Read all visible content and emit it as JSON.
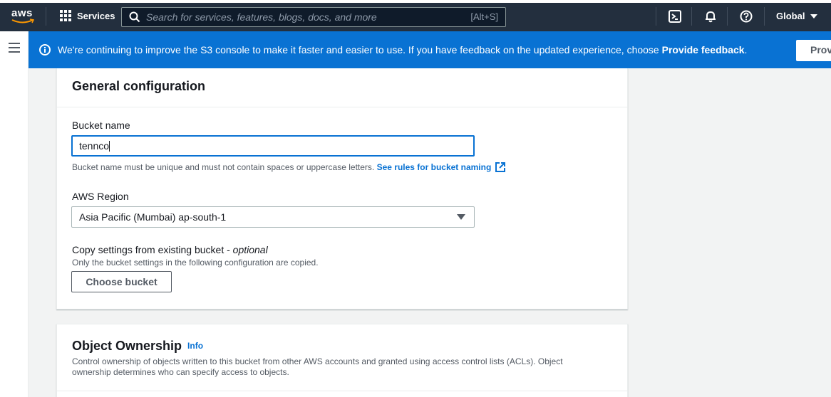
{
  "topnav": {
    "logo_text": "aws",
    "services_label": "Services",
    "search_placeholder": "Search for services, features, blogs, docs, and more",
    "search_shortcut": "[Alt+S]",
    "region_label": "Global",
    "icons": [
      "cloudshell-icon",
      "bell-icon",
      "help-icon",
      "caret-down-icon"
    ]
  },
  "flash": {
    "message_prefix": "We're continuing to improve the S3 console to make it faster and easier to use. If you have feedback on the updated experience, choose ",
    "message_link": "Provide feedback",
    "message_suffix": ".",
    "button_label": "Provide feedback"
  },
  "general": {
    "title": "General configuration",
    "bucket_name_label": "Bucket name",
    "bucket_name_value": "tennco",
    "bucket_name_hint": "Bucket name must be unique and must not contain spaces or uppercase letters.",
    "bucket_rules_link": "See rules for bucket naming",
    "region_label": "AWS Region",
    "region_value": "Asia Pacific (Mumbai) ap-south-1",
    "copy_label": "Copy settings from existing bucket - ",
    "copy_optional": "optional",
    "copy_hint": "Only the bucket settings in the following configuration are copied.",
    "choose_bucket_button": "Choose bucket"
  },
  "ownership": {
    "title": "Object Ownership",
    "info_link": "Info",
    "description": "Control ownership of objects written to this bucket from other AWS accounts and granted using access control lists (ACLs). Object ownership determines who can specify access to objects."
  },
  "colors": {
    "nav_bg": "#232f3e",
    "flash_bg": "#0972d3",
    "link": "#0972d3",
    "page_bg": "#f2f3f3"
  }
}
